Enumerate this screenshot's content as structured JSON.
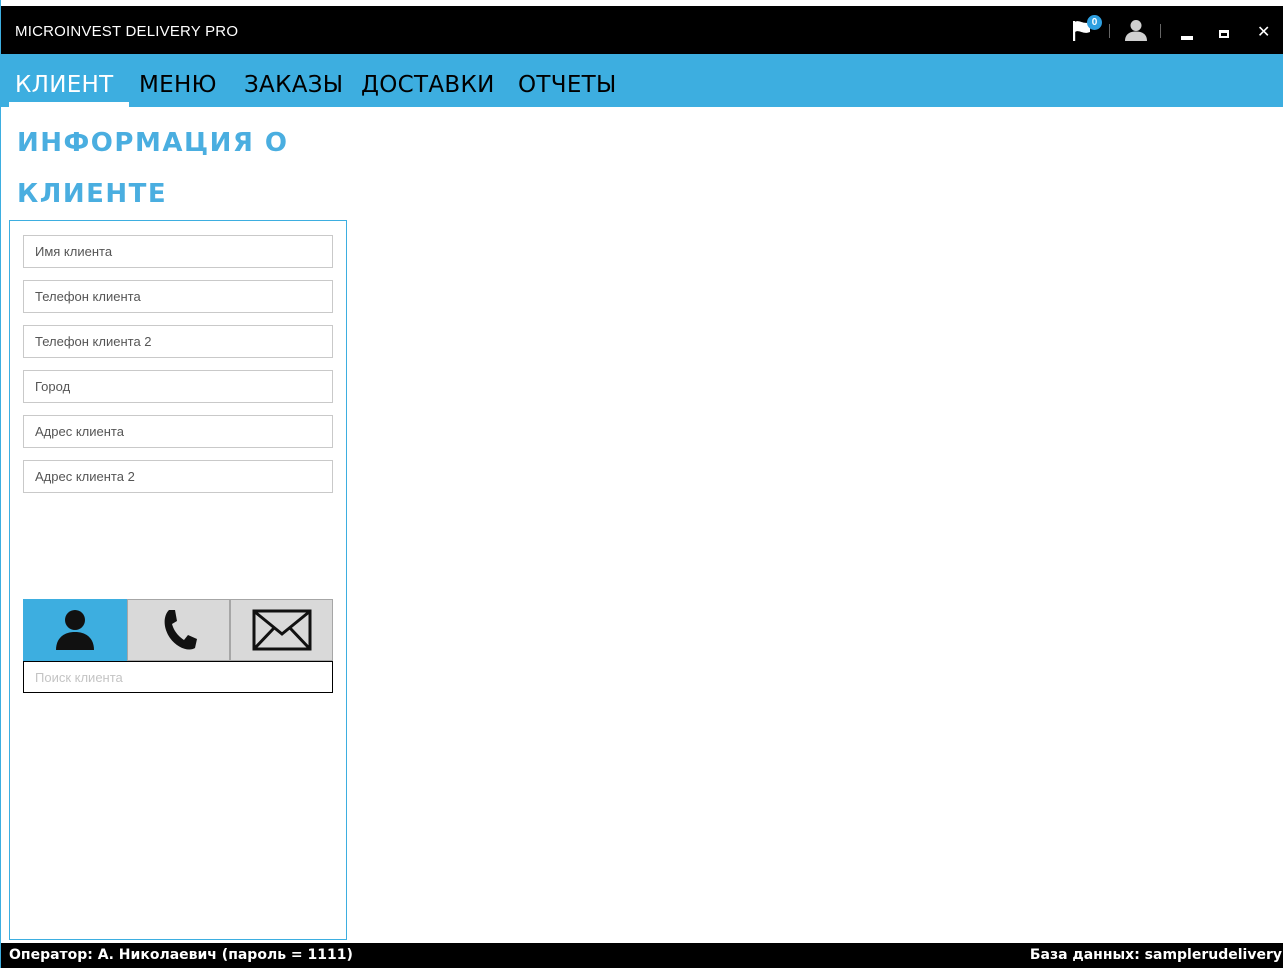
{
  "window": {
    "title": "MICROINVEST DELIVERY PRO",
    "notification_count": "0",
    "close_glyph": "✕"
  },
  "menu": {
    "items": [
      {
        "label": "КЛИЕНТ",
        "active": true
      },
      {
        "label": "МЕНЮ",
        "active": false
      },
      {
        "label": "ЗАКАЗЫ",
        "active": false
      },
      {
        "label": "ДОСТАВКИ",
        "active": false
      },
      {
        "label": "ОТЧЕТЫ",
        "active": false
      }
    ]
  },
  "section": {
    "title_line1": "ИНФОРМАЦИЯ О",
    "title_line2": "КЛИЕНТЕ"
  },
  "form": {
    "fields": [
      {
        "placeholder": "Имя клиента",
        "value": ""
      },
      {
        "placeholder": "Телефон клиента",
        "value": ""
      },
      {
        "placeholder": "Телефон клиента 2",
        "value": ""
      },
      {
        "placeholder": "Город",
        "value": ""
      },
      {
        "placeholder": "Адрес клиента",
        "value": ""
      },
      {
        "placeholder": "Адрес клиента 2",
        "value": ""
      }
    ],
    "search_modes": [
      {
        "icon": "person-icon",
        "active": true
      },
      {
        "icon": "phone-icon",
        "active": false
      },
      {
        "icon": "envelope-icon",
        "active": false
      }
    ],
    "search_placeholder": "Поиск клиента",
    "search_value": ""
  },
  "status": {
    "operator": "Оператор: А. Николаевич (пароль = 1111)",
    "database": "База данных: samplerudelivery"
  },
  "colors": {
    "accent": "#3daee0",
    "heading": "#4aaee0",
    "bar_background": "#000000"
  }
}
